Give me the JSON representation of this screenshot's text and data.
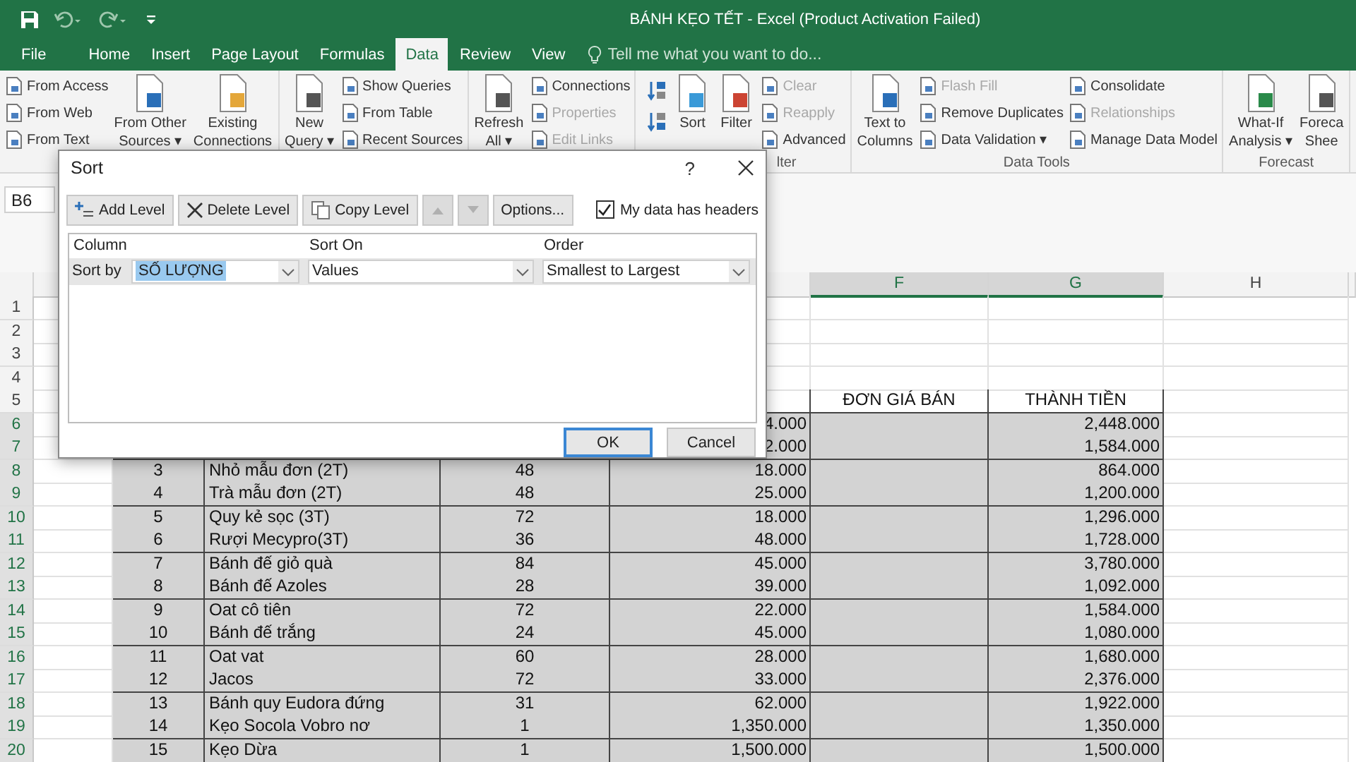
{
  "title_bar": {
    "title": "BÁNH KẸO TẾT  - Excel (Product Activation Failed)"
  },
  "tabs": [
    {
      "label": "File",
      "selected": false
    },
    {
      "label": "Home",
      "selected": false
    },
    {
      "label": "Insert",
      "selected": false
    },
    {
      "label": "Page Layout",
      "selected": false
    },
    {
      "label": "Formulas",
      "selected": false
    },
    {
      "label": "Data",
      "selected": true
    },
    {
      "label": "Review",
      "selected": false
    },
    {
      "label": "View",
      "selected": false
    }
  ],
  "tell_me": {
    "placeholder": "Tell me what you want to do..."
  },
  "ribbon": {
    "groups": [
      {
        "controls": [
          {
            "kind": "stack",
            "items": [
              {
                "label": "From Access",
                "disabled": false
              },
              {
                "label": "From Web",
                "disabled": false
              },
              {
                "label": "From Text",
                "disabled": false
              }
            ]
          },
          {
            "kind": "large",
            "lines": [
              "From Other",
              "Sources ▾"
            ]
          },
          {
            "kind": "large",
            "lines": [
              "Existing",
              "Connections"
            ]
          }
        ]
      },
      {
        "controls": [
          {
            "kind": "large",
            "lines": [
              "New",
              "Query ▾"
            ]
          },
          {
            "kind": "stack",
            "items": [
              {
                "label": "Show Queries",
                "disabled": false
              },
              {
                "label": "From Table",
                "disabled": false
              },
              {
                "label": "Recent Sources",
                "disabled": false
              }
            ]
          }
        ]
      },
      {
        "controls": [
          {
            "kind": "large",
            "lines": [
              "Refresh",
              "All ▾"
            ]
          },
          {
            "kind": "stack",
            "items": [
              {
                "label": "Connections",
                "disabled": false
              },
              {
                "label": "Properties",
                "disabled": true
              },
              {
                "label": "Edit Links",
                "disabled": true
              }
            ]
          }
        ]
      },
      {
        "label": "lter",
        "controls": [
          {
            "kind": "sort_pair"
          },
          {
            "kind": "large",
            "lines": [
              "Sort"
            ]
          },
          {
            "kind": "large",
            "lines": [
              "Filter"
            ]
          },
          {
            "kind": "stack",
            "items": [
              {
                "label": "Clear",
                "disabled": true
              },
              {
                "label": "Reapply",
                "disabled": true
              },
              {
                "label": "Advanced",
                "disabled": false
              }
            ]
          }
        ]
      },
      {
        "label": "Data Tools",
        "controls": [
          {
            "kind": "large",
            "lines": [
              "Text to",
              "Columns"
            ]
          },
          {
            "kind": "stack",
            "items": [
              {
                "label": "Flash Fill",
                "disabled": true
              },
              {
                "label": "Remove Duplicates",
                "disabled": false
              },
              {
                "label": "Data Validation  ▾",
                "disabled": false
              }
            ]
          },
          {
            "kind": "stack",
            "items": [
              {
                "label": "Consolidate",
                "disabled": false
              },
              {
                "label": "Relationships",
                "disabled": true
              },
              {
                "label": "Manage Data Model",
                "disabled": false
              }
            ]
          }
        ]
      },
      {
        "label": "Forecast",
        "controls": [
          {
            "kind": "large",
            "lines": [
              "What-If",
              "Analysis ▾"
            ]
          },
          {
            "kind": "large",
            "lines": [
              "Foreca",
              "Shee"
            ]
          }
        ]
      }
    ]
  },
  "name_box": {
    "value": "B6"
  },
  "sheet": {
    "column_headers": [
      {
        "label": "F",
        "selected": true
      },
      {
        "label": "G",
        "selected": true
      },
      {
        "label": "H",
        "selected": false
      }
    ],
    "rows": [
      {
        "number": "1",
        "selected": false
      },
      {
        "number": "2",
        "selected": false
      },
      {
        "number": "3",
        "selected": false
      },
      {
        "number": "4",
        "selected": false
      },
      {
        "number": "5",
        "selected": false,
        "kind": "header",
        "cells": {
          "F": "ĐƠN GIÁ BÁN",
          "G": "THÀNH TIỀN"
        }
      },
      {
        "number": "6",
        "selected": true,
        "kind": "data",
        "cells": {
          "E": "4.000",
          "G": "2,448.000"
        }
      },
      {
        "number": "7",
        "selected": true,
        "kind": "data",
        "cells": {
          "E": "2.000",
          "G": "1,584.000"
        }
      },
      {
        "number": "8",
        "selected": true,
        "kind": "data",
        "cells": {
          "B": "3",
          "C": "Nhỏ mẫu đơn (2T)",
          "D": "48",
          "E": "18.000",
          "G": "864.000"
        }
      },
      {
        "number": "9",
        "selected": true,
        "kind": "data",
        "cells": {
          "B": "4",
          "C": "Trà mẫu đơn (2T)",
          "D": "48",
          "E": "25.000",
          "G": "1,200.000"
        }
      },
      {
        "number": "10",
        "selected": true,
        "kind": "data",
        "cells": {
          "B": "5",
          "C": "Quy kẻ sọc (3T)",
          "D": "72",
          "E": "18.000",
          "G": "1,296.000"
        }
      },
      {
        "number": "11",
        "selected": true,
        "kind": "data",
        "cells": {
          "B": "6",
          "C": "Rượi Mecypro(3T)",
          "D": "36",
          "E": "48.000",
          "G": "1,728.000"
        }
      },
      {
        "number": "12",
        "selected": true,
        "kind": "data",
        "cells": {
          "B": "7",
          "C": "Bánh đế giỏ quà",
          "D": "84",
          "E": "45.000",
          "G": "3,780.000"
        }
      },
      {
        "number": "13",
        "selected": true,
        "kind": "data",
        "cells": {
          "B": "8",
          "C": "Bánh đế Azoles",
          "D": "28",
          "E": "39.000",
          "G": "1,092.000"
        }
      },
      {
        "number": "14",
        "selected": true,
        "kind": "data",
        "cells": {
          "B": "9",
          "C": "Oat cô tiên",
          "D": "72",
          "E": "22.000",
          "G": "1,584.000"
        }
      },
      {
        "number": "15",
        "selected": true,
        "kind": "data",
        "cells": {
          "B": "10",
          "C": "Bánh đế trắng",
          "D": "24",
          "E": "45.000",
          "G": "1,080.000"
        }
      },
      {
        "number": "16",
        "selected": true,
        "kind": "data",
        "cells": {
          "B": "11",
          "C": "Oat vat",
          "D": "60",
          "E": "28.000",
          "G": "1,680.000"
        }
      },
      {
        "number": "17",
        "selected": true,
        "kind": "data",
        "cells": {
          "B": "12",
          "C": "Jacos",
          "D": "72",
          "E": "33.000",
          "G": "2,376.000"
        }
      },
      {
        "number": "18",
        "selected": true,
        "kind": "data",
        "cells": {
          "B": "13",
          "C": "Bánh quy Eudora đứng",
          "D": "31",
          "E": "62.000",
          "G": "1,922.000"
        }
      },
      {
        "number": "19",
        "selected": true,
        "kind": "data",
        "cells": {
          "B": "14",
          "C": "Kẹo Socola Vobro nơ",
          "D": "1",
          "E": "1,350.000",
          "G": "1,350.000"
        }
      },
      {
        "number": "20",
        "selected": true,
        "kind": "data",
        "cells": {
          "B": "15",
          "C": "Kẹo Dừa",
          "D": "1",
          "E": "1,500.000",
          "G": "1,500.000"
        }
      }
    ]
  },
  "dialog": {
    "title": "Sort",
    "help": "?",
    "toolbar": [
      {
        "kind": "add",
        "label": "Add Level",
        "disabled": false
      },
      {
        "kind": "delete",
        "label": "Delete Level",
        "disabled": false
      },
      {
        "kind": "copy",
        "label": "Copy Level",
        "disabled": false
      },
      {
        "kind": "up",
        "disabled": true
      },
      {
        "kind": "down",
        "disabled": true
      },
      {
        "kind": "text",
        "label": "Options...",
        "disabled": false
      }
    ],
    "headers_checkbox": {
      "label": "My data has headers",
      "checked": true
    },
    "columns": [
      "Column",
      "Sort On",
      "Order"
    ],
    "levels": [
      {
        "label": "Sort by",
        "column": "SỐ LƯỢNG",
        "sort_on": "Values",
        "order": "Smallest to Largest",
        "selected": true
      }
    ],
    "buttons": [
      {
        "label": "OK",
        "default": true
      },
      {
        "label": "Cancel",
        "default": false
      }
    ]
  }
}
